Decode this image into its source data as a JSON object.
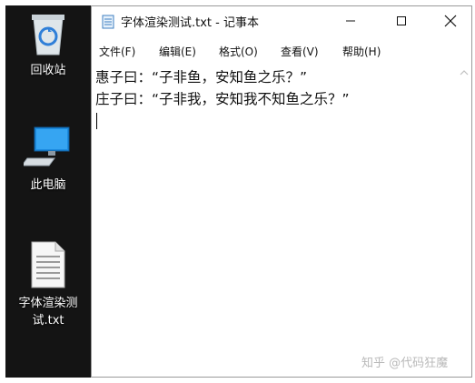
{
  "desktop": {
    "items": [
      {
        "label": "回收站",
        "icon": "recycle-bin-icon"
      },
      {
        "label": "此电脑",
        "icon": "computer-icon"
      },
      {
        "label_line1": "字体渲染测",
        "label_line2": "试.txt",
        "icon": "text-file-icon"
      }
    ]
  },
  "window": {
    "title": "字体渲染测试.txt - 记事本",
    "menu": [
      "文件(F)",
      "编辑(E)",
      "格式(O)",
      "查看(V)",
      "帮助(H)"
    ],
    "lines": [
      "惠子曰：“子非鱼，安知鱼之乐？”",
      "庄子曰：“子非我，安知我不知鱼之乐？”"
    ]
  },
  "watermark": "知乎 @代码狂魔",
  "colors": {
    "desktop_bg": "#141414",
    "window_border": "#9a9a9a",
    "watermark": "#b9b9b9"
  }
}
